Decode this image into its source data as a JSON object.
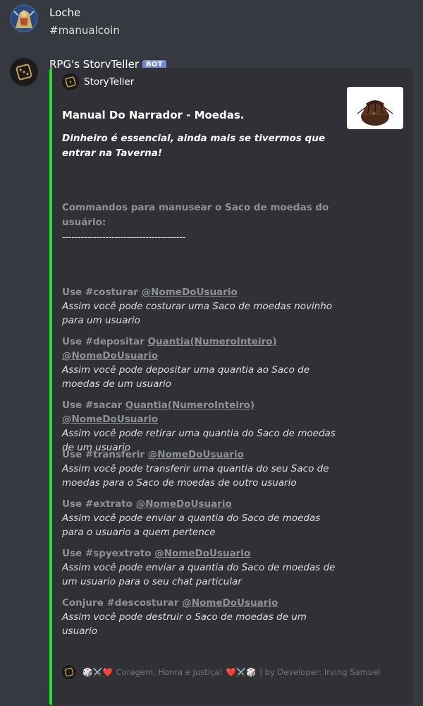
{
  "message1": {
    "username": "Loche",
    "text": "#manualcoin"
  },
  "message2": {
    "username": "RPG's StoryTeller",
    "bot_tag": "BOT",
    "embed": {
      "author": "StoryTeller",
      "title": "Manual Do Narrador - Moedas.",
      "description": "Dinheiro é essencial, ainda mais se tivermos que entrar na Taverna!",
      "section_heading": "Commandos para manusear o Saco de moedas do usuário:",
      "divider": "----------------------------------------",
      "commands": [
        {
          "prefix": "Use #costurar ",
          "args": "@NomeDoUsuario",
          "desc": "Assim você pode costurar uma Saco de moedas novinho para um usuario"
        },
        {
          "prefix": "Use #depositar ",
          "args": "Quantia(NumeroInteiro) @NomeDoUsuario",
          "desc": "Assim você pode depositar uma quantia ao Saco de moedas de um usuario"
        },
        {
          "prefix": "Use #sacar ",
          "args": "Quantia(NumeroInteiro) @NomeDoUsuario",
          "desc": "Assim você pode retirar uma quantia do Saco de moedas de um usuario"
        },
        {
          "prefix": "Use #transferir ",
          "args": "@NomeDoUsuario",
          "desc": "Assim você pode transferir uma quantia do seu Saco de moedas para o Saco de moedas de outro usuario"
        },
        {
          "prefix": "Use #extrato ",
          "args": "@NomeDoUsuario",
          "desc": "Assim você pode enviar a quantia do Saco de moedas para o usuario a quem pertence"
        },
        {
          "prefix": "Use #spyextrato ",
          "args": "@NomeDoUsuario",
          "desc": "Assim você pode enviar a quantia do Saco de moedas de um usuario para o seu chat particular"
        },
        {
          "prefix": "Conjure #descosturar ",
          "args": "@NomeDoUsuario",
          "desc": "Assim você pode destruir o Saco de moedas de um usuario"
        }
      ],
      "footer": {
        "emojis_left": "🎲⚔️❤️",
        "motto": " Coragem, Honra e Justiça! ",
        "emojis_right": "❤️⚔️🎲",
        "credit": " | by Developer: Irving Samuel "
      }
    }
  },
  "colors": {
    "background": "#36393f",
    "embed_bg": "#2f3136",
    "embed_border": "#1fe528",
    "bot_tag": "#7289da"
  }
}
